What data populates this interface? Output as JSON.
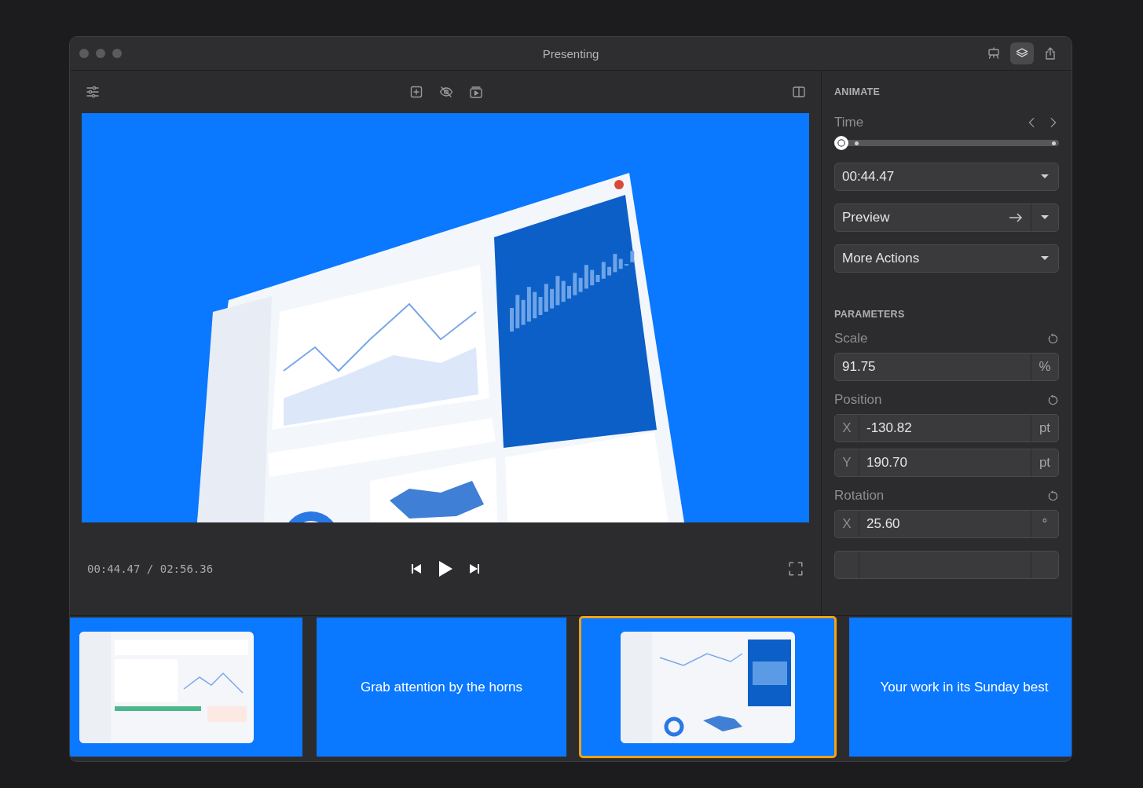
{
  "window": {
    "title": "Presenting"
  },
  "title_tools": [
    {
      "kind": "presenter",
      "selected": false
    },
    {
      "kind": "layers",
      "selected": true
    },
    {
      "kind": "share",
      "selected": false
    }
  ],
  "playback": {
    "time": "00:44.47 / 02:56.36"
  },
  "animate": {
    "heading": "ANIMATE",
    "time_label": "Time",
    "level": 0,
    "time_value": "00:44.47",
    "preview_button": "Preview",
    "more_actions": "More Actions"
  },
  "parameters": {
    "heading": "PARAMETERS",
    "groups": [
      {
        "label": "Scale",
        "fields": [
          {
            "value": "91.75",
            "unit": "%"
          }
        ]
      },
      {
        "label": "Position",
        "fields": [
          {
            "axis": "X",
            "value": "-130.82",
            "unit": "pt"
          },
          {
            "axis": "Y",
            "value": "190.70",
            "unit": "pt"
          }
        ]
      },
      {
        "label": "Rotation",
        "fields": [
          {
            "axis": "X",
            "value": "25.60",
            "unit": "°"
          }
        ]
      }
    ]
  },
  "slides": [
    {
      "kind": "screenshot",
      "selected": false
    },
    {
      "kind": "title",
      "text": "Grab attention by the horns",
      "selected": false
    },
    {
      "kind": "screenshot",
      "selected": true
    },
    {
      "kind": "title",
      "text": "Your work in its Sunday best",
      "selected": false
    }
  ]
}
